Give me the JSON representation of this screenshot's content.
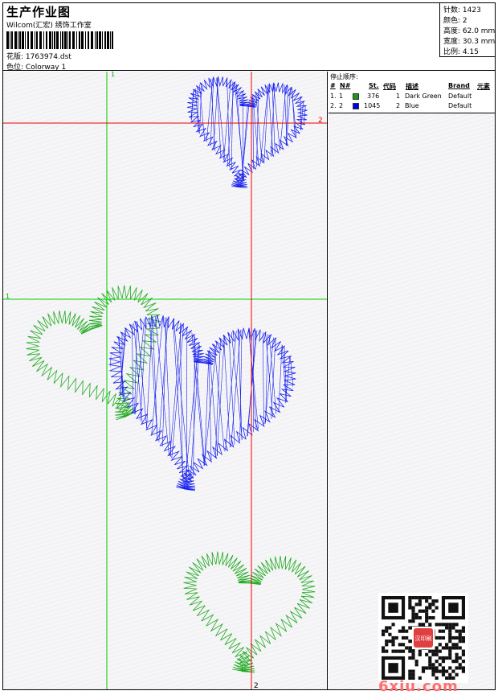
{
  "header": {
    "title": "生产作业图",
    "subtitle": "Wilcom(汇宏) 绣饰工作室",
    "file_label": "花版:",
    "file_name": "1763974.dst",
    "colorway_label": "色位:",
    "colorway": "Colorway 1"
  },
  "stats": {
    "stitches": "针数: 1423",
    "colors": "颜色: 2",
    "height": "高度: 62.0 mm",
    "width": "宽度: 30.3 mm",
    "ratio": "比例: 4.15"
  },
  "stop_sequence": {
    "label": "停止顺序:",
    "columns": [
      "#",
      "N#",
      "St.",
      "代码",
      "描述",
      "Brand",
      "元素"
    ],
    "rows": [
      {
        "index": "1.",
        "n": "1",
        "stitches": "376",
        "code": "1",
        "description": "Dark Green",
        "brand": "Default",
        "color": "#1a9a1a"
      },
      {
        "index": "2.",
        "n": "2",
        "stitches": "1045",
        "code": "2",
        "description": "Blue",
        "brand": "Default",
        "color": "#0000ee"
      }
    ]
  },
  "guides": {
    "v1": "1",
    "h2": "2",
    "h1": "1",
    "v2": "2"
  },
  "colors": {
    "green_thread": "#22aa22",
    "blue_thread": "#1a22ee",
    "guide_green": "#00cc00",
    "guide_red": "#ee0000",
    "watermark": "#ff6f6f"
  },
  "watermark": "6xiu.com",
  "qr_badge": "汉印刷"
}
